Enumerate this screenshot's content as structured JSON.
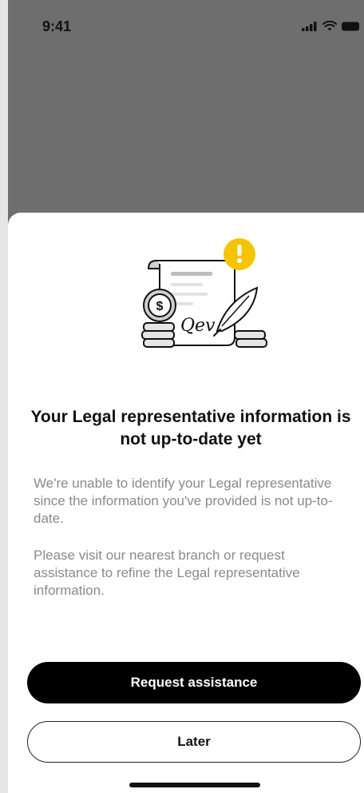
{
  "status_bar": {
    "time": "9:41"
  },
  "sheet": {
    "title": "Your Legal representative information is not up-to-date yet",
    "paragraph_1": "We're unable to identify your Legal representative since the information you've provided is not up-to-date.",
    "paragraph_2": "Please visit our nearest branch or request assistance to refine the Legal representative information.",
    "primary_button_label": "Request assistance",
    "secondary_button_label": "Later"
  },
  "illustration": {
    "signature_text": "Qev",
    "icons": [
      "document-icon",
      "warning-icon",
      "dollar-coin-icon",
      "feather-pen-icon",
      "coin-stack-icon"
    ]
  },
  "colors": {
    "overlay": "#6e6e6e",
    "warning": "#f5c400",
    "primary_button": "#000000",
    "text_primary": "#111111",
    "text_secondary": "#8a8a8a"
  }
}
